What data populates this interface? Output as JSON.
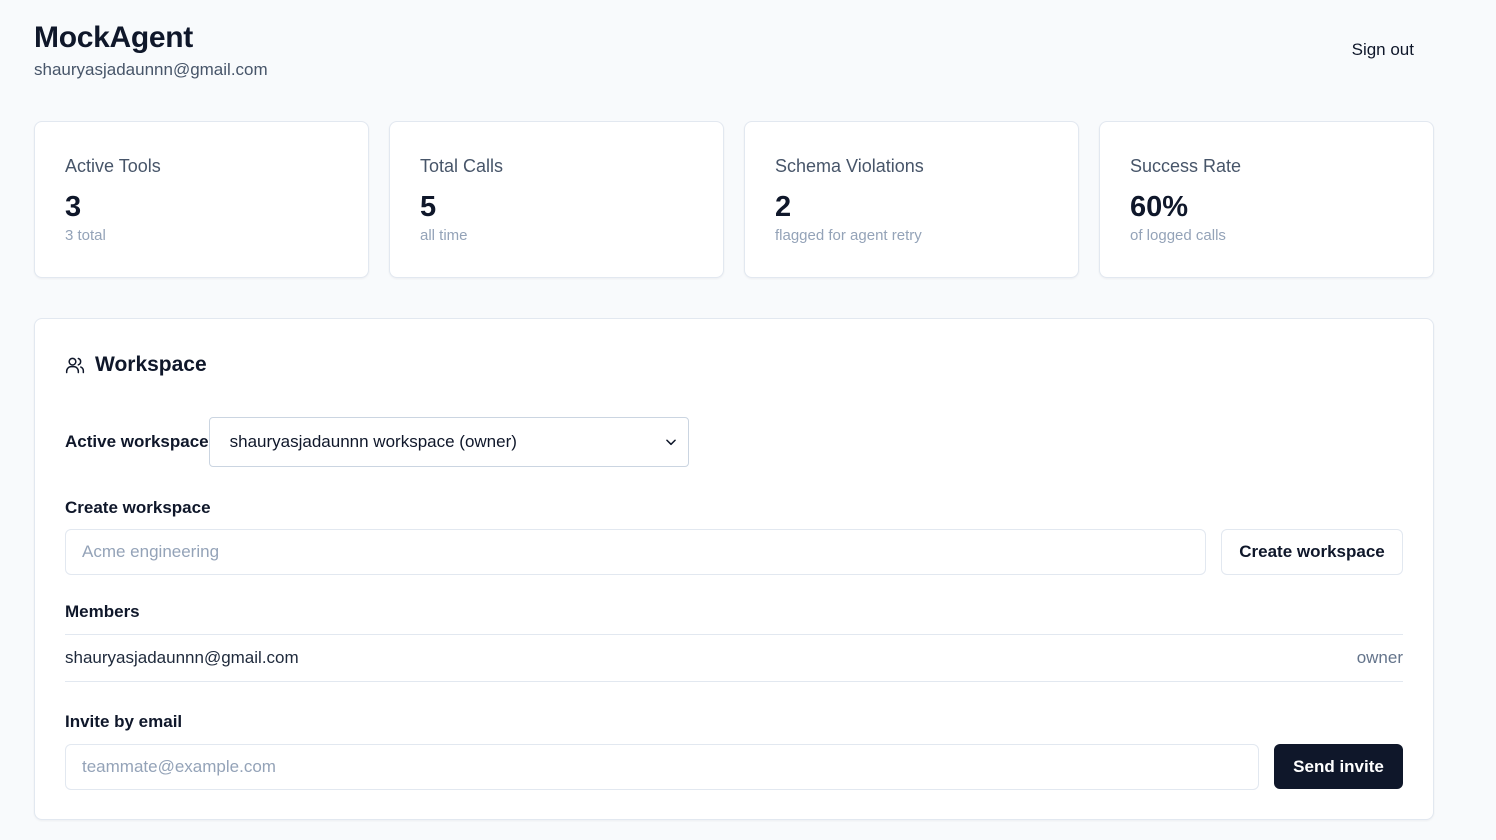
{
  "header": {
    "app_title": "MockAgent",
    "user_email": "shauryasjadaunnn@gmail.com",
    "signout_label": "Sign out"
  },
  "stats": [
    {
      "label": "Active Tools",
      "value": "3",
      "sub": "3 total"
    },
    {
      "label": "Total Calls",
      "value": "5",
      "sub": "all time"
    },
    {
      "label": "Schema Violations",
      "value": "2",
      "sub": "flagged for agent retry"
    },
    {
      "label": "Success Rate",
      "value": "60%",
      "sub": "of logged calls"
    }
  ],
  "workspace": {
    "title": "Workspace",
    "icon": "users-icon",
    "active_label": "Active workspace",
    "active_value": "shauryasjadaunnn workspace (owner)",
    "create_label": "Create workspace",
    "create_placeholder": "Acme engineering",
    "create_button": "Create workspace",
    "members_label": "Members",
    "members": [
      {
        "email": "shauryasjadaunnn@gmail.com",
        "role": "owner"
      }
    ],
    "invite_label": "Invite by email",
    "invite_placeholder": "teammate@example.com",
    "invite_button": "Send invite"
  }
}
